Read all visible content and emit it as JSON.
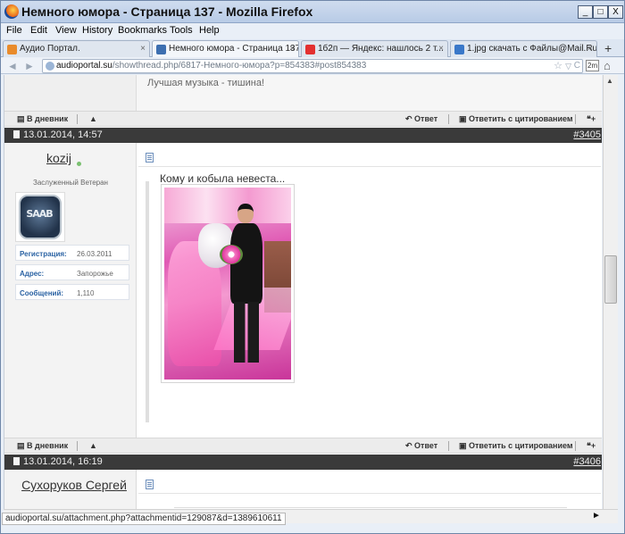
{
  "window": {
    "title": "Немного юмора - Страница 137 - Mozilla Firefox",
    "minimize": "_",
    "maximize": "□",
    "close": "X"
  },
  "menu": [
    "File",
    "Edit",
    "View",
    "History",
    "Bookmarks",
    "Tools",
    "Help"
  ],
  "tabs": [
    {
      "label": "Аудио Портал.",
      "close": "×",
      "icon_color": "#e98b2b"
    },
    {
      "label": "Немного юмора - Страница 137",
      "close": "×",
      "icon_color": "#3d6fb0"
    },
    {
      "label": "1б2п — Яндекс: нашлось 2 т...",
      "close": "×",
      "icon_color": "#e33030"
    },
    {
      "label": "1.jpg скачать с Файлы@Mail.Ru",
      "close": "×",
      "icon_color": "#3a78c9"
    }
  ],
  "newtab": "+",
  "nav": {
    "back": "◄",
    "forward": "►",
    "url_host": "audioportal.su",
    "url_rest": "/showthread.php/6817-Немного-юмора?p=854383#post854383",
    "star": "☆",
    "dropdown": "▽",
    "reload": "C",
    "zoom": "2m",
    "home": "⌂"
  },
  "prev_post": {
    "signature": "Лучшая музыка - тишина!"
  },
  "actions": {
    "diary": "В дневник",
    "reply": "Ответ",
    "quote_reply": "Ответить с цитированием",
    "warn": "▲",
    "multiquote": "❝+"
  },
  "post1": {
    "date": "13.01.2014, 14:57",
    "number": "#3405",
    "username": "kozij",
    "user_title": "Заслуженный Ветеран",
    "avatar_text": "SAAB",
    "info": [
      {
        "key": "Регистрация:",
        "value": "26.03.2011"
      },
      {
        "key": "Адрес:",
        "value": "Запорожье"
      },
      {
        "key": "Сообщений:",
        "value": "1,110"
      }
    ],
    "message": "Кому и кобыла невеста..."
  },
  "post2": {
    "date": "13.01.2014, 16:19",
    "number": "#3406",
    "username": "Сухоруков Сергей"
  },
  "status_url": "audioportal.su/attachment.php?attachmentid=129087&d=1389610611",
  "scroll": {
    "up": "▲",
    "right": "►"
  }
}
